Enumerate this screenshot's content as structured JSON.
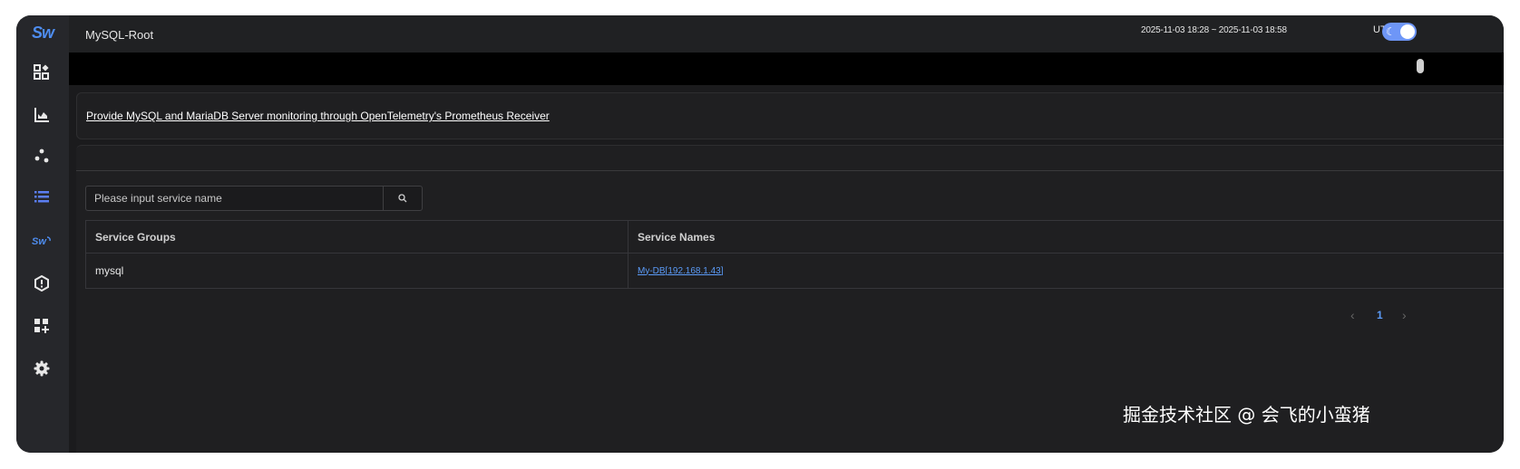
{
  "app": {
    "logo_text": "Sw",
    "title": "MySQL-Root"
  },
  "header": {
    "time_range": "2025-11-03 18:28 ~ 2025-11-03 18:58",
    "timezone": "UTC+0:0",
    "dark_mode": true
  },
  "sidebar": {
    "items": [
      {
        "icon": "dashboard-icon"
      },
      {
        "icon": "chart-icon"
      },
      {
        "icon": "topology-icon"
      },
      {
        "icon": "list-icon",
        "active": true
      },
      {
        "icon": "skywalking-icon"
      },
      {
        "icon": "alert-icon"
      },
      {
        "icon": "add-widget-icon"
      },
      {
        "icon": "settings-icon"
      }
    ]
  },
  "description": {
    "link_text": "Provide MySQL and MariaDB Server monitoring through OpenTelemetry's Prometheus Receiver"
  },
  "search": {
    "placeholder": "Please input service name",
    "value": ""
  },
  "table": {
    "headers": [
      "Service Groups",
      "Service Names"
    ],
    "rows": [
      {
        "group": "mysql",
        "service": "My-DB[192.168.1.43]"
      }
    ]
  },
  "pagination": {
    "current_page": "1",
    "prev": "‹",
    "next": "›"
  },
  "watermark": "掘金技术社区 @ 会飞的小蛮猪",
  "colors": {
    "accent": "#5b9bf7",
    "toggle": "#6e96f7",
    "sidebar": "#26272b",
    "background": "#1b1b1d"
  }
}
